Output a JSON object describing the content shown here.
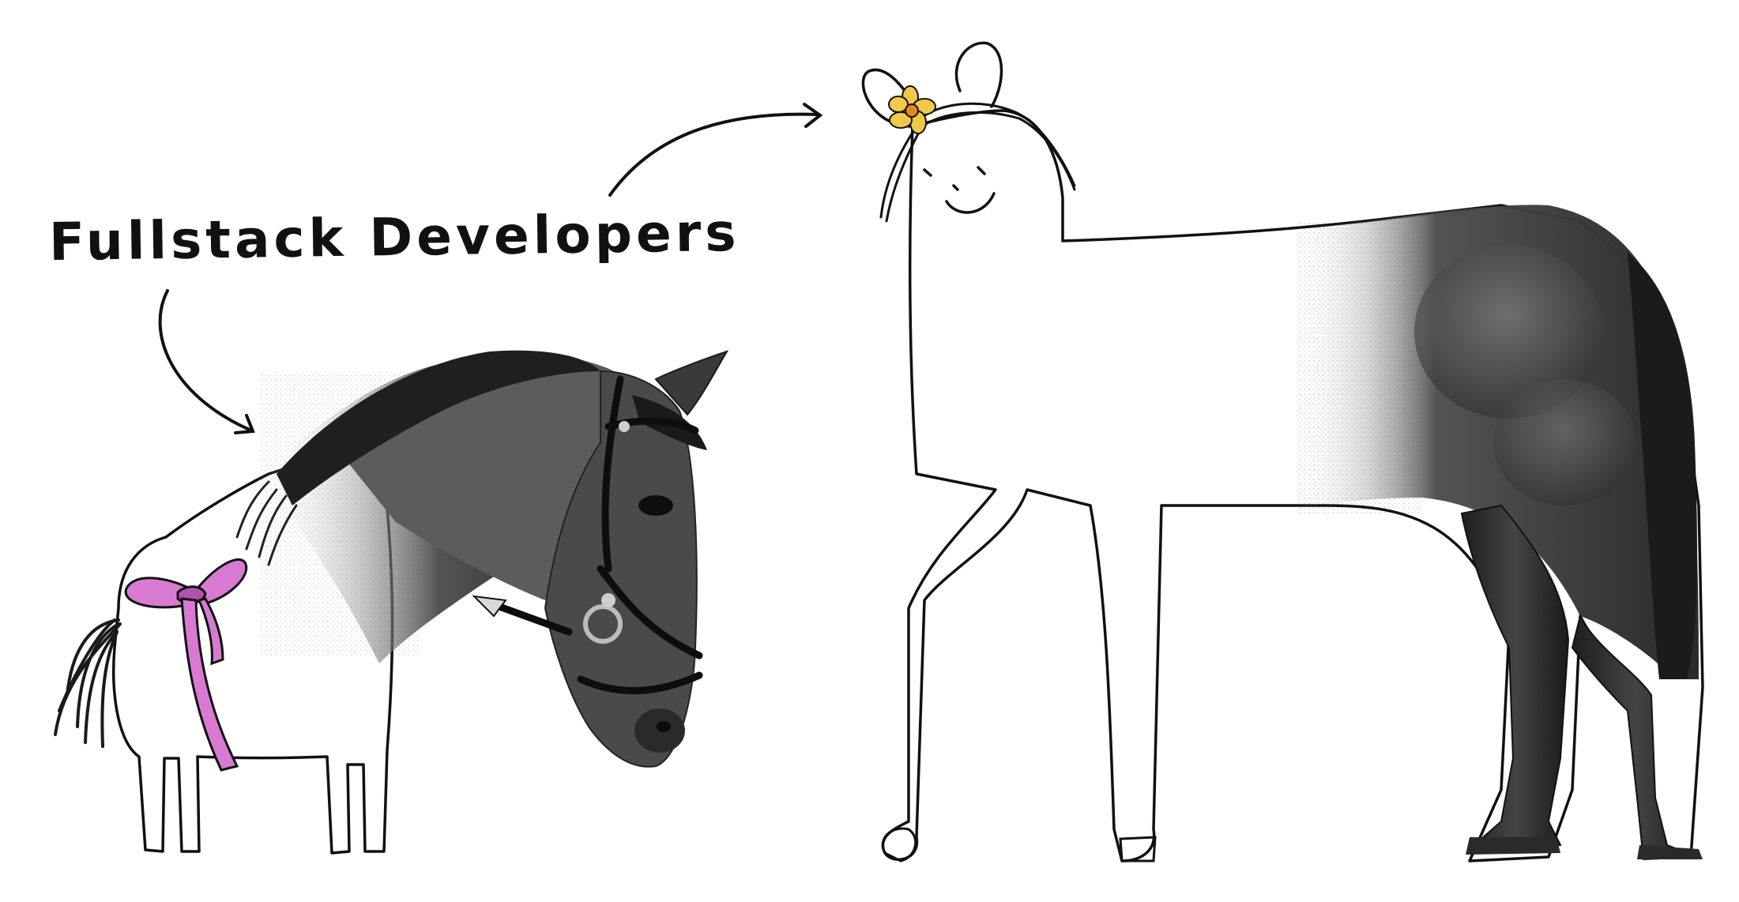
{
  "caption": "Fullstack Developers",
  "colors": {
    "ink": "#111111",
    "paper": "#ffffff",
    "ribbon": "#d97ad2",
    "ribbon_shadow": "#b452ad",
    "flower": "#f2c84b",
    "flower_center": "#e08a1e",
    "horse_dark": "#2b2b2b",
    "horse_mid": "#5a5a5a"
  },
  "figures": {
    "left": "horse-head-on-doodle-body",
    "right": "doodle-head-on-horse-body"
  }
}
